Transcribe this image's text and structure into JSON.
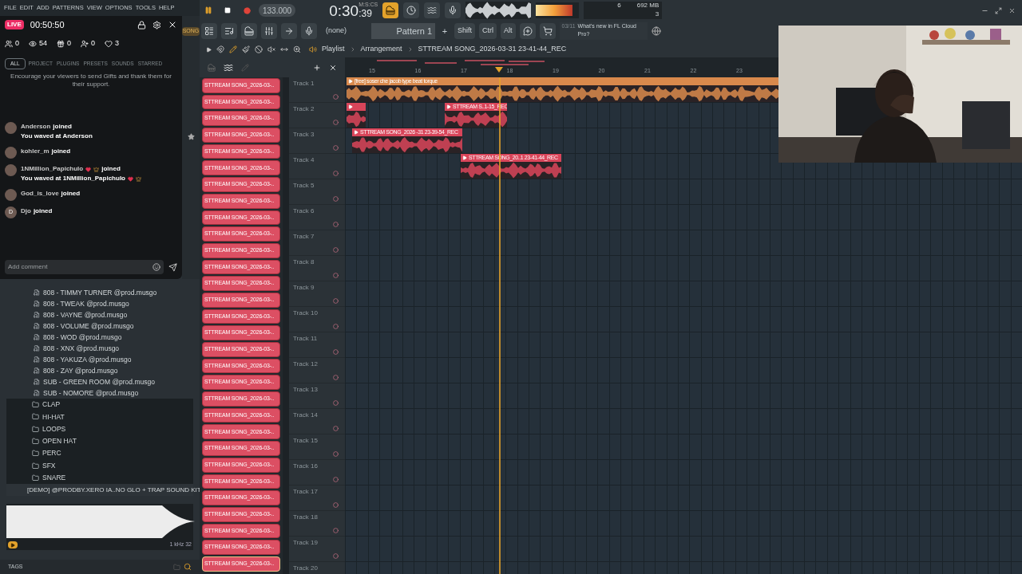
{
  "menu": [
    "FILE",
    "EDIT",
    "ADD",
    "PATTERNS",
    "VIEW",
    "OPTIONS",
    "TOOLS",
    "HELP"
  ],
  "mode_button": "SONG",
  "live": {
    "badge": "LIVE",
    "duration": "00:50:50",
    "stats": [
      {
        "kind": "members",
        "value": "0"
      },
      {
        "kind": "viewers",
        "value": "54"
      },
      {
        "kind": "gifts",
        "value": "0"
      },
      {
        "kind": "follows",
        "value": "0"
      },
      {
        "kind": "likes",
        "value": "3"
      }
    ]
  },
  "browser_tabs": [
    {
      "label": "ALL",
      "selected": true
    },
    {
      "label": "PROJECT",
      "selected": false
    },
    {
      "label": "PLUGINS",
      "selected": false
    },
    {
      "label": "PRESETS",
      "selected": false
    },
    {
      "label": "SOUNDS",
      "selected": false
    },
    {
      "label": "STARRED",
      "selected": false
    }
  ],
  "overlay_hint": "Encourage your viewers to send Gifts and thank them for their support.",
  "chat": [
    {
      "user": "Anderson",
      "action": "joined",
      "note": "You waved at Anderson"
    },
    {
      "user": "kohler_m",
      "action": "joined"
    },
    {
      "user": "1NMillion_Papichulo",
      "action": "joined",
      "note": "You waved at 1NMillion_Papichulo",
      "emojis": true
    },
    {
      "user": "God_is_love",
      "action": "joined"
    },
    {
      "user": "Djo",
      "action": "joined",
      "avatar_letter": "D"
    }
  ],
  "comment_placeholder": "Add comment",
  "browser_items": [
    {
      "kind": "file",
      "label": "808 - TIMMY TURNER @prod.musgo"
    },
    {
      "kind": "file",
      "label": "808 - TWEAK @prod.musgo"
    },
    {
      "kind": "file",
      "label": "808 - VAYNE @prod.musgo"
    },
    {
      "kind": "file",
      "label": "808 - VOLUME @prod.musgo"
    },
    {
      "kind": "file",
      "label": "808 - WOD @prod.musgo"
    },
    {
      "kind": "file",
      "label": "808 - XNX @prod.musgo"
    },
    {
      "kind": "file",
      "label": "808 - YAKUZA @prod.musgo"
    },
    {
      "kind": "file",
      "label": "808 - ZAY @prod.musgo"
    },
    {
      "kind": "file",
      "label": "SUB - GREEN ROOM @prod.musgo"
    },
    {
      "kind": "file",
      "label": "SUB - NOMORE @prod.musgo"
    },
    {
      "kind": "folder",
      "label": "CLAP"
    },
    {
      "kind": "folder",
      "label": "HI-HAT"
    },
    {
      "kind": "folder",
      "label": "LOOPS"
    },
    {
      "kind": "folder",
      "label": "OPEN HAT"
    },
    {
      "kind": "folder",
      "label": "PERC"
    },
    {
      "kind": "folder",
      "label": "SFX"
    },
    {
      "kind": "folder",
      "label": "SNARE"
    },
    {
      "kind": "pack",
      "label": "[DEMO] @PRODBY.XERO IA..NO GLO + TRAP SOUND KIT"
    }
  ],
  "preview_info": "1 kHz 32",
  "tags_label": "TAGS",
  "transport": {
    "playing": true,
    "recording": false,
    "tempo": "133.000",
    "time": "0:30",
    "time_fraction": ":39",
    "time_label": "M:S:CS"
  },
  "monitor": {
    "cpu": "6",
    "memory": "692 MB",
    "polyphony": "3",
    "level": 0.85
  },
  "pattern_selector": "(none)",
  "pattern": "Pattern 1",
  "pattern_add": "+",
  "modifier_keys": [
    "Shift",
    "Ctrl",
    "Alt"
  ],
  "news": {
    "date": "03/11",
    "text": "What's new in FL Cloud Pro?"
  },
  "playlist": {
    "breadcrumb": [
      "Playlist",
      "Arrangement",
      "STTREAM SONG_2026-03-31 23-41-44_REC"
    ],
    "ruler": [
      "15",
      "16",
      "17",
      "18",
      "19",
      "20",
      "21",
      "22",
      "23"
    ],
    "clip_list": [
      {
        "label": "STTREAM SONG_2026-03-..",
        "selected": false
      },
      {
        "label": "STTREAM SONG_2026-03-..",
        "selected": false
      },
      {
        "label": "STTREAM SONG_2026-03-..",
        "selected": false
      },
      {
        "label": "STTREAM SONG_2026-03-..",
        "selected": false
      },
      {
        "label": "STTREAM SONG_2026-03-..",
        "selected": false
      },
      {
        "label": "STTREAM SONG_2026-03-..",
        "selected": false
      },
      {
        "label": "STTREAM SONG_2026-03-..",
        "selected": false
      },
      {
        "label": "STTREAM SONG_2026-03-..",
        "selected": false
      },
      {
        "label": "STTREAM SONG_2026-03-..",
        "selected": false
      },
      {
        "label": "STTREAM SONG_2026-03-..",
        "selected": false
      },
      {
        "label": "STTREAM SONG_2026-03-..",
        "selected": false
      },
      {
        "label": "STTREAM SONG_2026-03-..",
        "selected": false
      },
      {
        "label": "STTREAM SONG_2026-03-..",
        "selected": false
      },
      {
        "label": "STTREAM SONG_2026-03-..",
        "selected": false
      },
      {
        "label": "STTREAM SONG_2026-03-..",
        "selected": false
      },
      {
        "label": "STTREAM SONG_2026-03-..",
        "selected": false
      },
      {
        "label": "STTREAM SONG_2026-03-..",
        "selected": false
      },
      {
        "label": "STTREAM SONG_2026-03-..",
        "selected": false
      },
      {
        "label": "STTREAM SONG_2026-03-..",
        "selected": false
      },
      {
        "label": "STTREAM SONG_2026-03-..",
        "selected": false
      },
      {
        "label": "STTREAM SONG_2026-03-..",
        "selected": false
      },
      {
        "label": "STTREAM SONG_2026-03-..",
        "selected": false
      },
      {
        "label": "STTREAM SONG_2026-03-..",
        "selected": false
      },
      {
        "label": "STTREAM SONG_2026-03-..",
        "selected": false
      },
      {
        "label": "STTREAM SONG_2026-03-..",
        "selected": false
      },
      {
        "label": "STTREAM SONG_2026-03-..",
        "selected": false
      },
      {
        "label": "STTREAM SONG_2026-03-..",
        "selected": false
      },
      {
        "label": "STTREAM SONG_2026-03-..",
        "selected": false
      },
      {
        "label": "STTREAM SONG_2026-03-..",
        "selected": false
      },
      {
        "label": "STTREAM SONG_2026-03-..",
        "selected": true
      }
    ],
    "tracks": [
      {
        "name": "Track 1",
        "clips": [
          {
            "label": "[free] soser che jacob type beat torque",
            "color": "#d9894c"
          }
        ]
      },
      {
        "name": "Track 2",
        "clips": [
          {
            "color": "#d9455a"
          },
          {
            "label": "STTREAM S..1-15_REC",
            "color": "#d9455a"
          }
        ]
      },
      {
        "name": "Track 3",
        "clips": [
          {
            "label": "STTREAM SONG_2026 -31 23-39-54_REC",
            "color": "#d9455a"
          }
        ]
      },
      {
        "name": "Track 4",
        "clips": [
          {
            "label": "STTREAM SONG_20..1 23-41-44_REC",
            "color": "#d9455a"
          }
        ]
      },
      {
        "name": "Track 5"
      },
      {
        "name": "Track 6"
      },
      {
        "name": "Track 7"
      },
      {
        "name": "Track 8"
      },
      {
        "name": "Track 9"
      },
      {
        "name": "Track 10"
      },
      {
        "name": "Track 11"
      },
      {
        "name": "Track 12"
      },
      {
        "name": "Track 13"
      },
      {
        "name": "Track 14"
      },
      {
        "name": "Track 15"
      },
      {
        "name": "Track 16"
      },
      {
        "name": "Track 17"
      },
      {
        "name": "Track 18"
      },
      {
        "name": "Track 19"
      },
      {
        "name": "Track 20"
      }
    ]
  }
}
